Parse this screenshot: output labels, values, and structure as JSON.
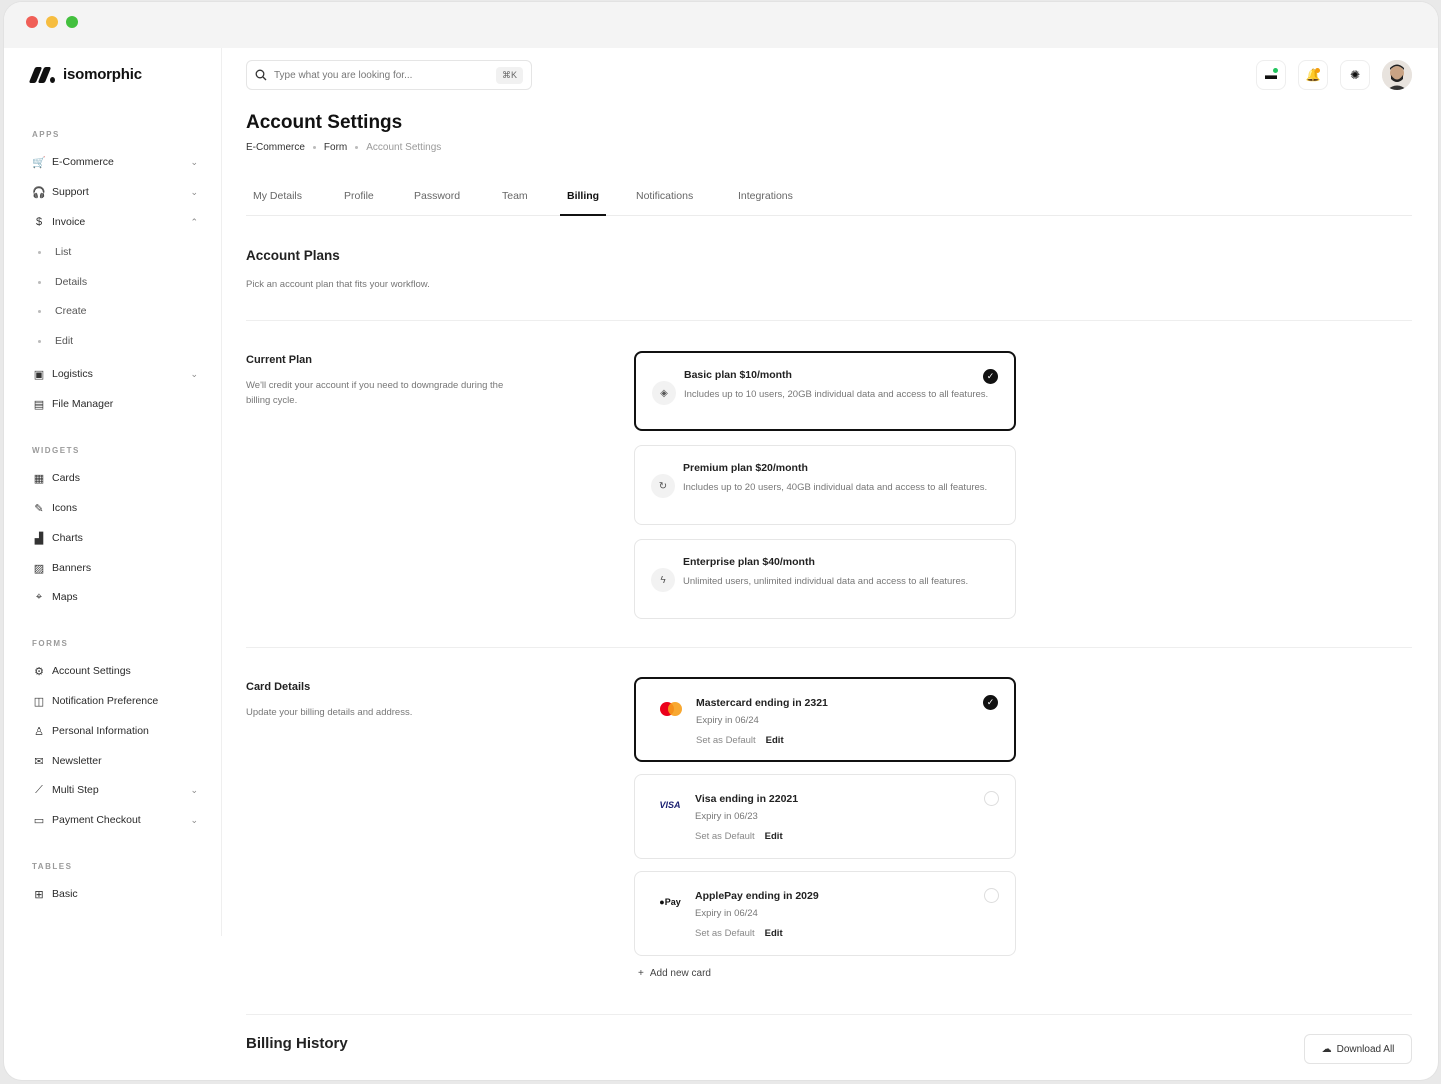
{
  "brand": {
    "name": "isomorphic"
  },
  "sidebar": {
    "groups": {
      "apps": "APPS",
      "widgets": "WIDGETS",
      "forms": "FORMS",
      "tables": "TABLES"
    },
    "apps": [
      {
        "label": "E-Commerce",
        "icon": "cart-icon",
        "chevron": "down"
      },
      {
        "label": "Support",
        "icon": "headset-icon",
        "chevron": "down"
      },
      {
        "label": "Invoice",
        "icon": "dollar-icon",
        "chevron": "up"
      }
    ],
    "invoice_sub": [
      "List",
      "Details",
      "Create",
      "Edit"
    ],
    "apps_more": [
      {
        "label": "Logistics",
        "icon": "box-icon",
        "chevron": "down"
      },
      {
        "label": "File Manager",
        "icon": "file-icon"
      }
    ],
    "widgets": [
      {
        "label": "Cards",
        "icon": "grid-icon"
      },
      {
        "label": "Icons",
        "icon": "feather-icon"
      },
      {
        "label": "Charts",
        "icon": "chart-icon"
      },
      {
        "label": "Banners",
        "icon": "image-icon"
      },
      {
        "label": "Maps",
        "icon": "map-pin-icon"
      }
    ],
    "forms": [
      {
        "label": "Account Settings",
        "icon": "user-gear-icon"
      },
      {
        "label": "Notification Preference",
        "icon": "bell-icon"
      },
      {
        "label": "Personal Information",
        "icon": "user-icon"
      },
      {
        "label": "Newsletter",
        "icon": "mail-icon"
      },
      {
        "label": "Multi Step",
        "icon": "steps-icon",
        "chevron": "down"
      },
      {
        "label": "Payment Checkout",
        "icon": "credit-card-icon",
        "chevron": "down"
      }
    ],
    "tables": [
      {
        "label": "Basic",
        "icon": "table-icon"
      }
    ]
  },
  "search": {
    "placeholder": "Type what you are looking for...",
    "shortcut": "⌘K"
  },
  "header": {
    "title": "Account Settings",
    "breadcrumb": [
      "E-Commerce",
      "Form",
      "Account Settings"
    ]
  },
  "tabs": [
    "My Details",
    "Profile",
    "Password",
    "Team",
    "Billing",
    "Notifications",
    "Integrations"
  ],
  "active_tab": "Billing",
  "account_plans": {
    "title": "Account Plans",
    "desc": "Pick an account plan that fits your workflow."
  },
  "current_plan": {
    "label": "Current Plan",
    "desc": "We'll credit your account if you need to downgrade during the billing cycle.",
    "plans": [
      {
        "title": "Basic plan $10/month",
        "desc": "Includes up to 10 users, 20GB individual data and access to all features.",
        "selected": true,
        "icon": "layers-icon"
      },
      {
        "title": "Premium plan $20/month",
        "desc": "Includes up to 20 users, 40GB individual data and access to all features.",
        "selected": false,
        "icon": "refresh-icon"
      },
      {
        "title": "Enterprise plan $40/month",
        "desc": "Unlimited users, unlimited individual data and access to all features.",
        "selected": false,
        "icon": "bolt-icon"
      }
    ]
  },
  "card_details": {
    "label": "Card Details",
    "desc": "Update your billing details and address.",
    "cards": [
      {
        "title": "Mastercard ending in 2321",
        "expiry": "Expiry in 06/24",
        "set_default": "Set as Default",
        "edit": "Edit",
        "selected": true,
        "brand": "mastercard"
      },
      {
        "title": "Visa ending in 22021",
        "expiry": "Expiry in 06/23",
        "set_default": "Set as Default",
        "edit": "Edit",
        "selected": false,
        "brand": "VISA"
      },
      {
        "title": "ApplePay ending in 2029",
        "expiry": "Expiry in 06/24",
        "set_default": "Set as Default",
        "edit": "Edit",
        "selected": false,
        "brand": "Pay"
      }
    ],
    "add_card": "Add new card"
  },
  "billing_history": {
    "title": "Billing History",
    "download_all": "Download All"
  },
  "colors": {
    "accent": "#111111",
    "mastercard_red": "#eb001b",
    "mastercard_orange": "#f79e1b",
    "visa_blue": "#1a1f71"
  }
}
